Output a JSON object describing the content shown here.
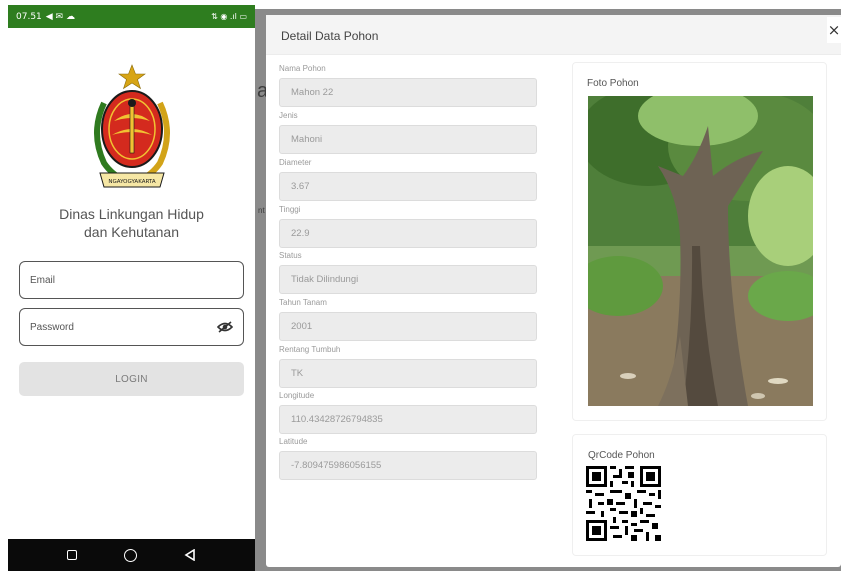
{
  "phone": {
    "status": {
      "time": "07.51",
      "left_icons": "◀ ✉ ☁",
      "right_icons": "⇅ ◉ .ıl ▭"
    },
    "agency_line1": "Dinas Linkungan Hidup",
    "agency_line2": "dan Kehutanan",
    "email_placeholder": "Email",
    "password_placeholder": "Password",
    "login_label": "LOGIN",
    "logo_text": "NGAYOGYAKARTA",
    "colors": {
      "statusbar": "#2e7d1f",
      "navbar": "#0a0a0a",
      "button": "#e3e3e3"
    }
  },
  "underlay": {
    "glimpse_a": "a",
    "glimpse_t": "nt"
  },
  "modal": {
    "title": "Detail Data Pohon",
    "close_label": "×",
    "fields": [
      {
        "label": "Nama Pohon",
        "value": "Mahon 22"
      },
      {
        "label": "Jenis",
        "value": "Mahoni"
      },
      {
        "label": "Diameter",
        "value": "3.67"
      },
      {
        "label": "Tinggi",
        "value": "22.9"
      },
      {
        "label": "Status",
        "value": "Tidak Dilindungi"
      },
      {
        "label": "Tahun Tanam",
        "value": "2001"
      },
      {
        "label": "Rentang Tumbuh",
        "value": "TK"
      },
      {
        "label": "Longitude",
        "value": "110.43428726794835"
      },
      {
        "label": "Latitude",
        "value": "-7.809475986056155"
      }
    ],
    "photo_label": "Foto Pohon",
    "qr_label": "QrCode Pohon"
  }
}
